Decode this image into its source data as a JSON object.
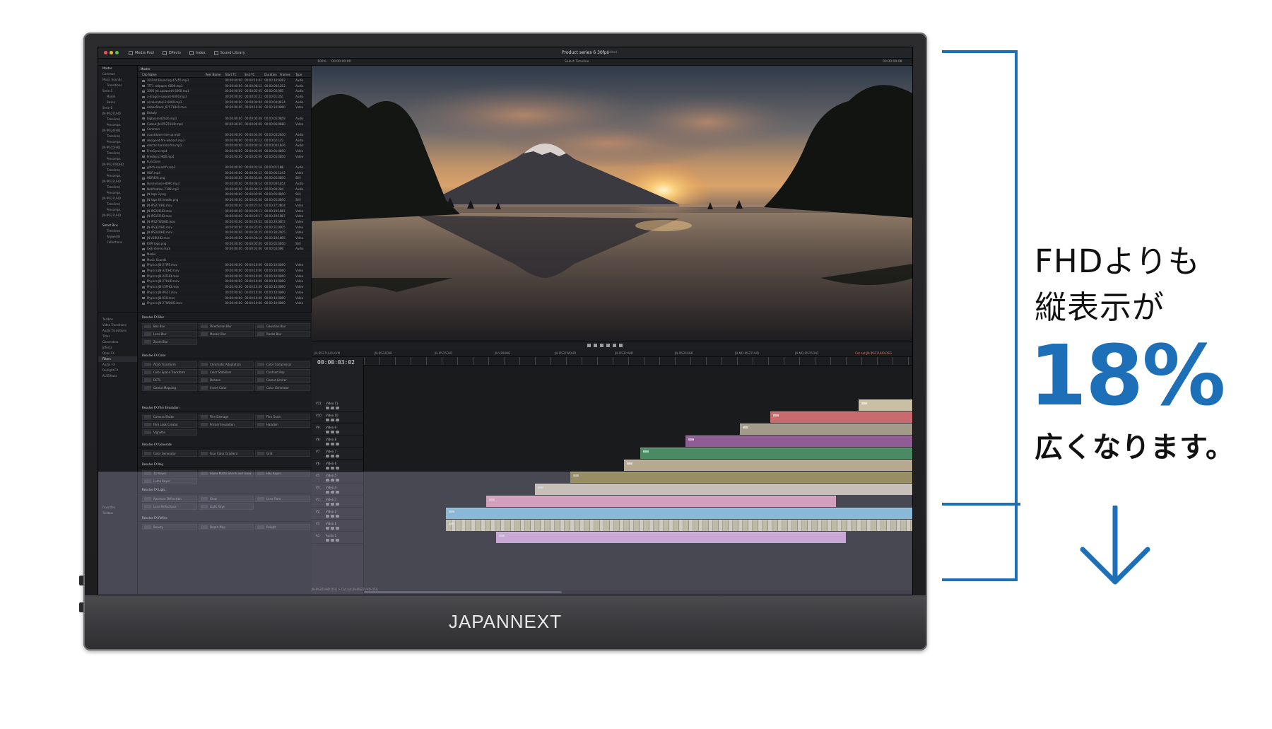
{
  "app": {
    "tabs": [
      "Media Pool",
      "Effects",
      "Index",
      "Sound Library"
    ],
    "project_title": "Product series 6 30fps",
    "edited": "Edited",
    "zoom": "100%",
    "timecode_top": "00:00:00:00",
    "timeline_select": "Select Timeline",
    "timecode_right": "00:00:09:08"
  },
  "bins": [
    "Master",
    "Common",
    "Music Sounds",
    "Transitions",
    "Serie 5",
    "Model",
    "Bases",
    "Serie 6",
    "JN-IPS27UHD",
    "Timelines",
    "Precomps",
    "JN-IPS24FHD",
    "Timelines",
    "Precomps",
    "JN-IPS15FHD",
    "Timelines",
    "Precomps",
    "JN-IPS27WQHD",
    "Timelines",
    "Precomps",
    "JN-IPS32UHD",
    "Timelines",
    "Precomps",
    "JN-IPS27UHD",
    "Timelines",
    "Precomps",
    "JN-IPS27UHD"
  ],
  "smart_bins": [
    "Smart Bins",
    "Timelines",
    "Keywords",
    "Collections"
  ],
  "media": {
    "header": "Master",
    "columns": [
      "Clip Name",
      "Reel Name",
      "Start TC",
      "End TC",
      "Duration",
      "Frames",
      "Type"
    ],
    "rows": [
      [
        "30 First Bouncing 47455.mp3",
        "00:00:00:00",
        "00:00:10:02",
        "00:00:10:02",
        "302",
        "Audio"
      ],
      [
        "TFT1 rollpaper 6000.mp3",
        "00:00:00:00",
        "00:00:08:12",
        "00:00:08:12",
        "252",
        "Audio"
      ],
      [
        "3096 Jet upswoosh 6000.mp3",
        "00:00:00:00",
        "00:00:02:05",
        "00:00:02:05",
        "65",
        "Audio"
      ],
      [
        "a-dragon-swoosh-6000.mp3",
        "00:00:00:00",
        "00:00:01:21",
        "00:00:01:21",
        "51",
        "Audio"
      ],
      [
        "accelerated-2-6000.mp3",
        "00:00:00:00",
        "00:00:04:04",
        "00:00:04:04",
        "124",
        "Audio"
      ],
      [
        "AdobeStock_67571840.mov",
        "00:00:00:00",
        "00:00:10:00",
        "00:00:10:00",
        "300",
        "Video"
      ],
      [
        "Beauty",
        "",
        "",
        "",
        "",
        ""
      ],
      [
        "bigboom-82026.mp3",
        "00:00:00:00",
        "00:00:05:08",
        "00:00:05:08",
        "158",
        "Audio"
      ],
      [
        "Cutout JN-IPS27UHD.mp4",
        "00:00:00:00",
        "00:00:06:00",
        "00:00:06:00",
        "180",
        "Video"
      ],
      [
        "Common",
        "",
        "",
        "",
        "",
        ""
      ],
      [
        "countdown-rise-up.mp3",
        "00:00:00:00",
        "00:00:03:20",
        "00:00:03:20",
        "110",
        "Audio"
      ],
      [
        "designed-fire-whoosh.mp3",
        "00:00:00:00",
        "00:00:02:12",
        "00:00:02:12",
        "72",
        "Audio"
      ],
      [
        "electric-tension-fire.mp3",
        "00:00:00:00",
        "00:00:04:16",
        "00:00:04:16",
        "136",
        "Audio"
      ],
      [
        "FreeSync.mp4",
        "00:00:00:00",
        "00:00:05:00",
        "00:00:05:00",
        "150",
        "Video"
      ],
      [
        "FreeSync HDR.mp4",
        "00:00:00:00",
        "00:00:05:00",
        "00:00:05:00",
        "150",
        "Video"
      ],
      [
        "Functions",
        "",
        "",
        "",
        "",
        ""
      ],
      [
        "glitch-sound-fx.mp3",
        "00:00:00:00",
        "00:00:01:18",
        "00:00:01:18",
        "48",
        "Audio"
      ],
      [
        "HDR.mp4",
        "00:00:00:00",
        "00:00:06:12",
        "00:00:06:12",
        "192",
        "Video"
      ],
      [
        "HDR400.png",
        "00:00:00:00",
        "00:00:05:00",
        "00:00:05:00",
        "150",
        "Still"
      ],
      [
        "Honeymoon-8090.mp3",
        "00:00:00:00",
        "00:00:08:14",
        "00:00:08:14",
        "254",
        "Audio"
      ],
      [
        "Notification-7108.mp3",
        "00:00:00:00",
        "00:00:00:24",
        "00:00:00:24",
        "24",
        "Audio"
      ],
      [
        "JN logo 3.png",
        "00:00:00:00",
        "00:00:05:00",
        "00:00:05:00",
        "150",
        "Still"
      ],
      [
        "JN logo 4K header.png",
        "00:00:00:00",
        "00:00:05:00",
        "00:00:05:00",
        "150",
        "Still"
      ],
      [
        "JN-IPS27UHD.mov",
        "00:00:00:00",
        "00:00:27:24",
        "00:00:27:24",
        "834",
        "Video"
      ],
      [
        "JN-IPS24FHD.mov",
        "00:00:00:00",
        "00:00:29:11",
        "00:00:29:11",
        "881",
        "Video"
      ],
      [
        "JN-IPS15FHD.mov",
        "00:00:00:00",
        "00:00:29:17",
        "00:00:29:17",
        "887",
        "Video"
      ],
      [
        "JN-IPS27WQHD.mov",
        "00:00:00:00",
        "00:00:29:02",
        "00:00:29:02",
        "872",
        "Video"
      ],
      [
        "JN-IPS32UHD.mov",
        "00:00:00:00",
        "00:00:31:05",
        "00:00:31:05",
        "935",
        "Video"
      ],
      [
        "JN-IPS24UHD.mov",
        "00:00:00:00",
        "00:00:30:25",
        "00:00:30:25",
        "925",
        "Video"
      ],
      [
        "JN-V28UHD.mov",
        "00:00:00:00",
        "00:00:28:16",
        "00:00:28:16",
        "856",
        "Video"
      ],
      [
        "KVM logo.png",
        "00:00:00:00",
        "00:00:05:00",
        "00:00:05:00",
        "150",
        "Still"
      ],
      [
        "look-stereo.mp3",
        "00:00:00:00",
        "00:00:03:00",
        "00:00:03:00",
        "90",
        "Audio"
      ],
      [
        "Model",
        "",
        "",
        "",
        "",
        ""
      ],
      [
        "Music Sounds",
        "",
        "",
        "",
        "",
        ""
      ],
      [
        "Physics JN-27IPS.mov",
        "00:00:00:00",
        "00:00:10:00",
        "00:00:10:00",
        "300",
        "Video"
      ],
      [
        "Physics JN-32UHD.mov",
        "00:00:00:00",
        "00:00:10:00",
        "00:00:10:00",
        "300",
        "Video"
      ],
      [
        "Physics JN-24FHD.mov",
        "00:00:00:00",
        "00:00:10:00",
        "00:00:10:00",
        "300",
        "Video"
      ],
      [
        "Physics JN-27UHD.mov",
        "00:00:00:00",
        "00:00:10:00",
        "00:00:10:00",
        "300",
        "Video"
      ],
      [
        "Physics JN-15FHD.mov",
        "00:00:00:00",
        "00:00:10:00",
        "00:00:10:00",
        "300",
        "Video"
      ],
      [
        "Physics JN-IPS27.mov",
        "00:00:00:00",
        "00:00:10:00",
        "00:00:10:00",
        "300",
        "Video"
      ],
      [
        "Physics JN-V28.mov",
        "00:00:00:00",
        "00:00:10:00",
        "00:00:10:00",
        "300",
        "Video"
      ],
      [
        "Physics JN-27WQHD.mov",
        "00:00:00:00",
        "00:00:10:00",
        "00:00:10:00",
        "300",
        "Video"
      ]
    ]
  },
  "fx_nav": [
    "Toolbox",
    "Video Transitions",
    "Audio Transitions",
    "Titles",
    "Generators",
    "Effects",
    "Open FX",
    "Filters",
    "Audio FX",
    "Fairlight FX",
    "AU Effects"
  ],
  "fx_nav_bottom": [
    "Favorites",
    "Toolbox"
  ],
  "fx_groups": [
    {
      "title": "Resolve FX Blur",
      "items": [
        "Box Blur",
        "Directional Blur",
        "Gaussian Blur",
        "Lens Blur",
        "Mosaic Blur",
        "Radial Blur",
        "Zoom Blur"
      ]
    },
    {
      "title": "Resolve FX Color",
      "items": [
        "ACES Transform",
        "Chromatic Adaptation",
        "Color Compressor",
        "Color Space Transform",
        "Color Stabilizer",
        "Contrast Pop",
        "DCTL",
        "Dehaze",
        "Gamut Limiter",
        "Gamut Mapping",
        "Invert Color",
        "Color Generator"
      ]
    },
    {
      "title": "Resolve FX Film Emulation",
      "items": [
        "Camera Shake",
        "Film Damage",
        "Film Grain",
        "Film Look Creator",
        "Printer Emulation",
        "Halation",
        "Vignette"
      ]
    },
    {
      "title": "Resolve FX Generate",
      "items": [
        "Color Generator",
        "Four Color Gradient",
        "Grid"
      ]
    },
    {
      "title": "Resolve FX Key",
      "items": [
        "3D Keyer",
        "Alpha Matte Shrink and Grow",
        "HSL Keyer",
        "Luma Keyer"
      ]
    },
    {
      "title": "Resolve FX Light",
      "items": [
        "Aperture Diffraction",
        "Glow",
        "Lens Flare",
        "Lens Reflections",
        "Light Rays"
      ]
    },
    {
      "title": "Resolve FX Refine",
      "items": [
        "Beauty",
        "Depth Map",
        "Relight"
      ]
    }
  ],
  "timeline": {
    "timecode": "00:00:03:02",
    "tabs": [
      "JN-IPS27UHD-KVM",
      "JN-IPS24FHD",
      "JN-IPS15FHD",
      "JN-V28UHD",
      "JN-IPS27WQHD",
      "JN-IPS32UHD",
      "JN-IPS24UHD",
      "JN-MD-IPS27UHD",
      "JN-MD-IPS15FHD",
      "Cut out JN-IPS27UHD-DSG"
    ],
    "tracks": [
      {
        "id": "V11",
        "name": "Video 11"
      },
      {
        "id": "V10",
        "name": "Video 10"
      },
      {
        "id": "V9",
        "name": "Video 9"
      },
      {
        "id": "V8",
        "name": "Video 8"
      },
      {
        "id": "V7",
        "name": "Video 7"
      },
      {
        "id": "V6",
        "name": "Video 6"
      },
      {
        "id": "V5",
        "name": "Video 5"
      },
      {
        "id": "V4",
        "name": "Video 4"
      },
      {
        "id": "V3",
        "name": "Video 3"
      },
      {
        "id": "V2",
        "name": "Video 2"
      },
      {
        "id": "V1",
        "name": "Video 1"
      },
      {
        "id": "A1",
        "name": "Audio 1"
      }
    ],
    "clip_labels": [
      "Adjustment Clip",
      "Cutout"
    ],
    "footer": "JN-IPS27UHD-DSG  >  Cut out JN-IPS27UHD-DSG"
  },
  "monitor": {
    "brand": "JAPANNEXT"
  },
  "annotation": {
    "line1": "FHDよりも",
    "line2": "縦表示が",
    "percent": "18%",
    "line3": "広くなります。",
    "color": "#1d6fb7"
  }
}
